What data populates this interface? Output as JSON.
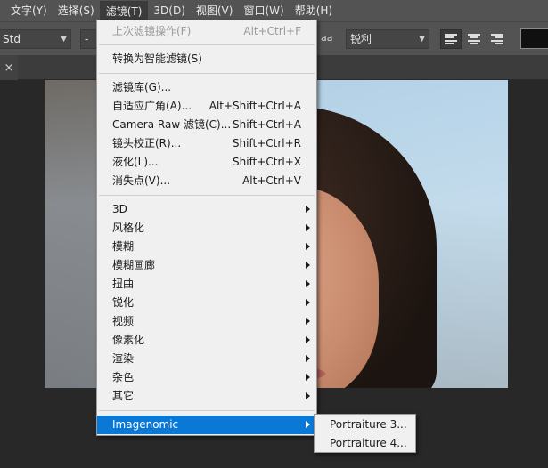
{
  "menubar": {
    "items": [
      "文字(Y)",
      "选择(S)",
      "滤镜(T)",
      "3D(D)",
      "视图(V)",
      "窗口(W)",
      "帮助(H)"
    ]
  },
  "options": {
    "font_style": "Std",
    "font_size": "-",
    "aa_icon": "aa",
    "antialias": "锐利",
    "color_swatch": "#101010"
  },
  "tabbar": {
    "close_glyph": "×"
  },
  "filter_menu": {
    "last_filter": {
      "label": "上次滤镜操作(F)",
      "shortcut": "Alt+Ctrl+F"
    },
    "convert_smart": {
      "label": "转换为智能滤镜(S)"
    },
    "gallery": {
      "label": "滤镜库(G)..."
    },
    "adaptive_wide": {
      "label": "自适应广角(A)...",
      "shortcut": "Alt+Shift+Ctrl+A"
    },
    "camera_raw": {
      "label": "Camera Raw 滤镜(C)...",
      "shortcut": "Shift+Ctrl+A"
    },
    "lens_correction": {
      "label": "镜头校正(R)...",
      "shortcut": "Shift+Ctrl+R"
    },
    "liquify": {
      "label": "液化(L)...",
      "shortcut": "Shift+Ctrl+X"
    },
    "vanishing_point": {
      "label": "消失点(V)...",
      "shortcut": "Alt+Ctrl+V"
    },
    "submenus": [
      "3D",
      "风格化",
      "模糊",
      "模糊画廊",
      "扭曲",
      "锐化",
      "视频",
      "像素化",
      "渲染",
      "杂色",
      "其它"
    ],
    "imagenomic": "Imagenomic"
  },
  "submenu": {
    "items": [
      "Portraiture 3...",
      "Portraiture 4..."
    ]
  },
  "colors": {
    "menu_highlight": "#0a78d7",
    "chrome": "#535353"
  }
}
